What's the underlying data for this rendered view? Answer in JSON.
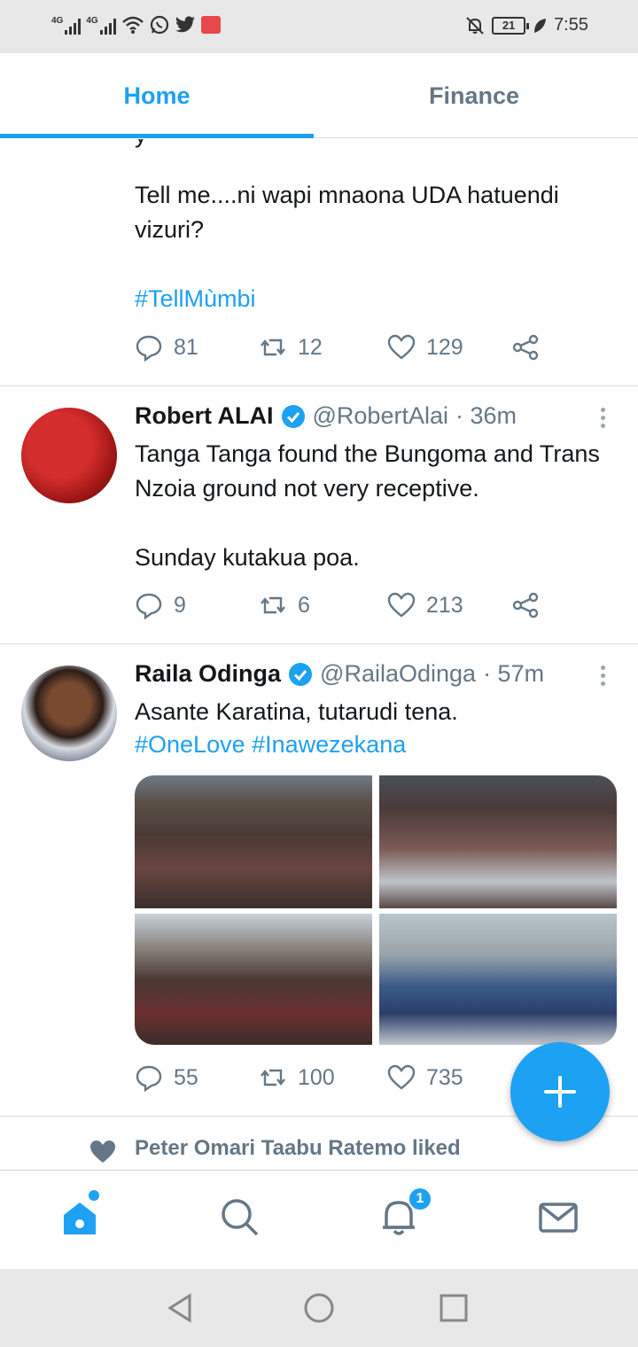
{
  "status_bar": {
    "network_1": "4G",
    "network_2": "4G",
    "battery": "21",
    "time": "7:55"
  },
  "tabs": [
    {
      "label": "Home",
      "active": true
    },
    {
      "label": "Finance",
      "active": false
    }
  ],
  "tweets": [
    {
      "partial_top": "y",
      "text_1": "Tell me....ni wapi mnaona UDA hatuendi vizuri?",
      "hashtags": "#TellMùmbi",
      "replies": "81",
      "retweets": "12",
      "likes": "129"
    },
    {
      "name": "Robert ALAI",
      "handle": "@RobertAlai",
      "time": "· 36m",
      "text_1": "Tanga Tanga found the Bungoma and Trans Nzoia ground not very receptive.",
      "text_2": "Sunday kutakua poa.",
      "replies": "9",
      "retweets": "6",
      "likes": "213"
    },
    {
      "name": "Raila Odinga",
      "handle": "@RailaOdinga",
      "time": "· 57m",
      "text_1": "Asante Karatina, tutarudi tena.",
      "hashtags": "#OneLove #Inawezekana",
      "replies": "55",
      "retweets": "100",
      "likes": "735"
    }
  ],
  "liked_banner": "Peter Omari Taabu Ratemo liked",
  "bottom_nav": {
    "notifications_badge": "1"
  },
  "colors": {
    "accent": "#1da1f2",
    "muted": "#657786",
    "text": "#14171a"
  }
}
